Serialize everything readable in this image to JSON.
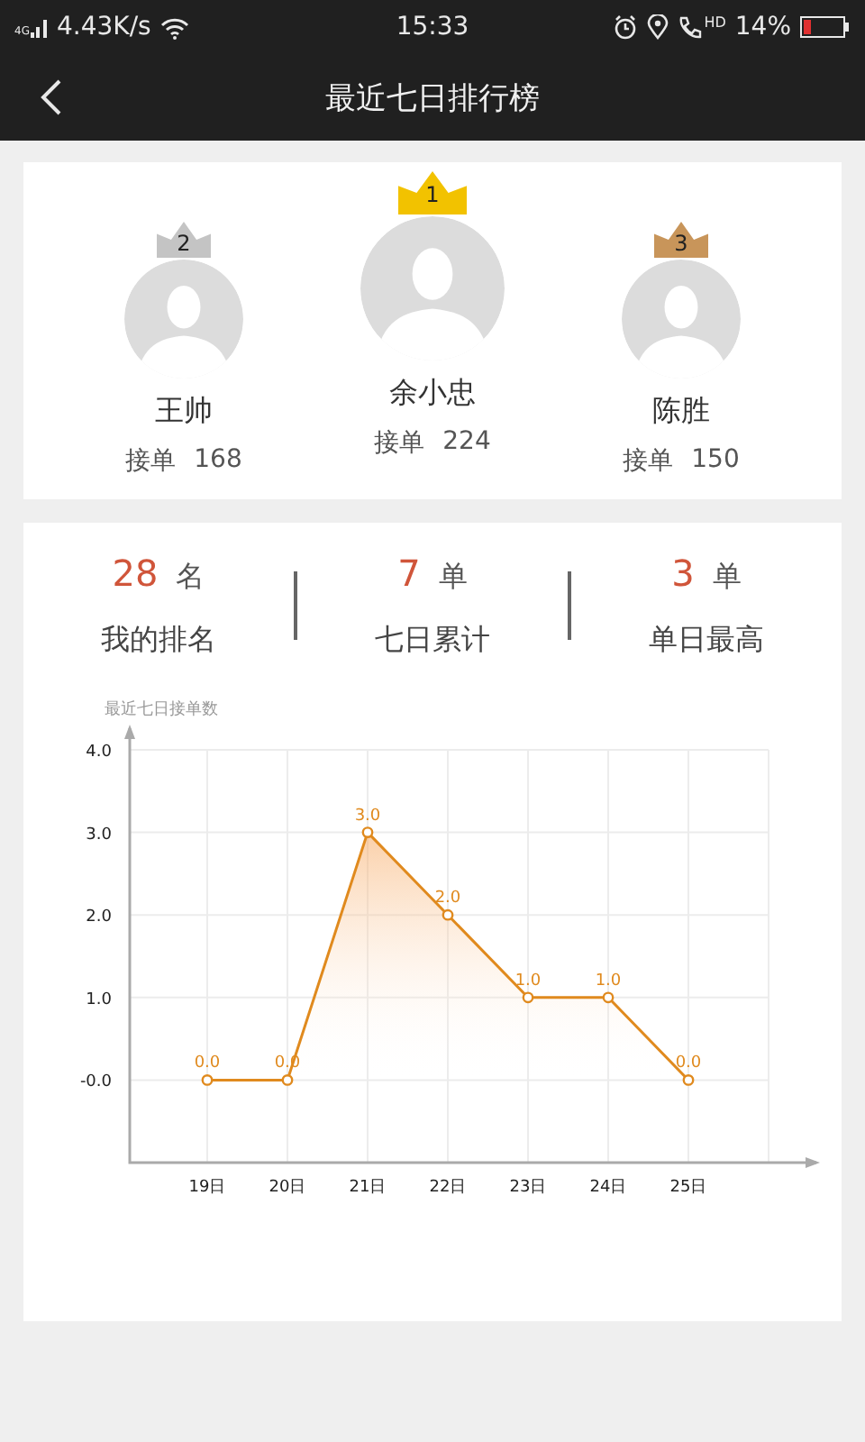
{
  "status_bar": {
    "network": "4G",
    "speed": "4.43K/s",
    "time": "15:33",
    "call_badge": "HD",
    "battery": "14%"
  },
  "header": {
    "title": "最近七日排行榜"
  },
  "podium": [
    {
      "rank": "2",
      "kind": "runner",
      "color": "#c4c4c4",
      "name": "王帅",
      "orders_label": "接单",
      "orders": "168"
    },
    {
      "rank": "1",
      "kind": "champion",
      "color": "#f2c200",
      "name": "余小忠",
      "orders_label": "接单",
      "orders": "224"
    },
    {
      "rank": "3",
      "kind": "runner",
      "color": "#c8955a",
      "name": "陈胜",
      "orders_label": "接单",
      "orders": "150"
    }
  ],
  "stats": [
    {
      "value": "28",
      "unit": "名",
      "label": "我的排名"
    },
    {
      "value": "7",
      "unit": "单",
      "label": "七日累计"
    },
    {
      "value": "3",
      "unit": "单",
      "label": "单日最高"
    }
  ],
  "chart_data": {
    "type": "area",
    "ylabel": "最近七日接单数",
    "categories": [
      "19日",
      "20日",
      "21日",
      "22日",
      "23日",
      "24日",
      "25日"
    ],
    "series": [
      {
        "color": "#e08a1e",
        "values": [
          0,
          0,
          3,
          2,
          1,
          1,
          0
        ],
        "value_labels": [
          "0.0",
          "0.0",
          "3.0",
          "2.0",
          "1.0",
          "1.0",
          "0.0"
        ]
      }
    ],
    "grid": true,
    "ylim": [
      -1,
      4
    ],
    "yticks": [
      {
        "value": 0,
        "label": "-0.0"
      },
      {
        "value": 1,
        "label": "1.0"
      },
      {
        "value": 2,
        "label": "2.0"
      },
      {
        "value": 3,
        "label": "3.0"
      },
      {
        "value": 4,
        "label": "4.0"
      }
    ],
    "data_labels": true
  }
}
